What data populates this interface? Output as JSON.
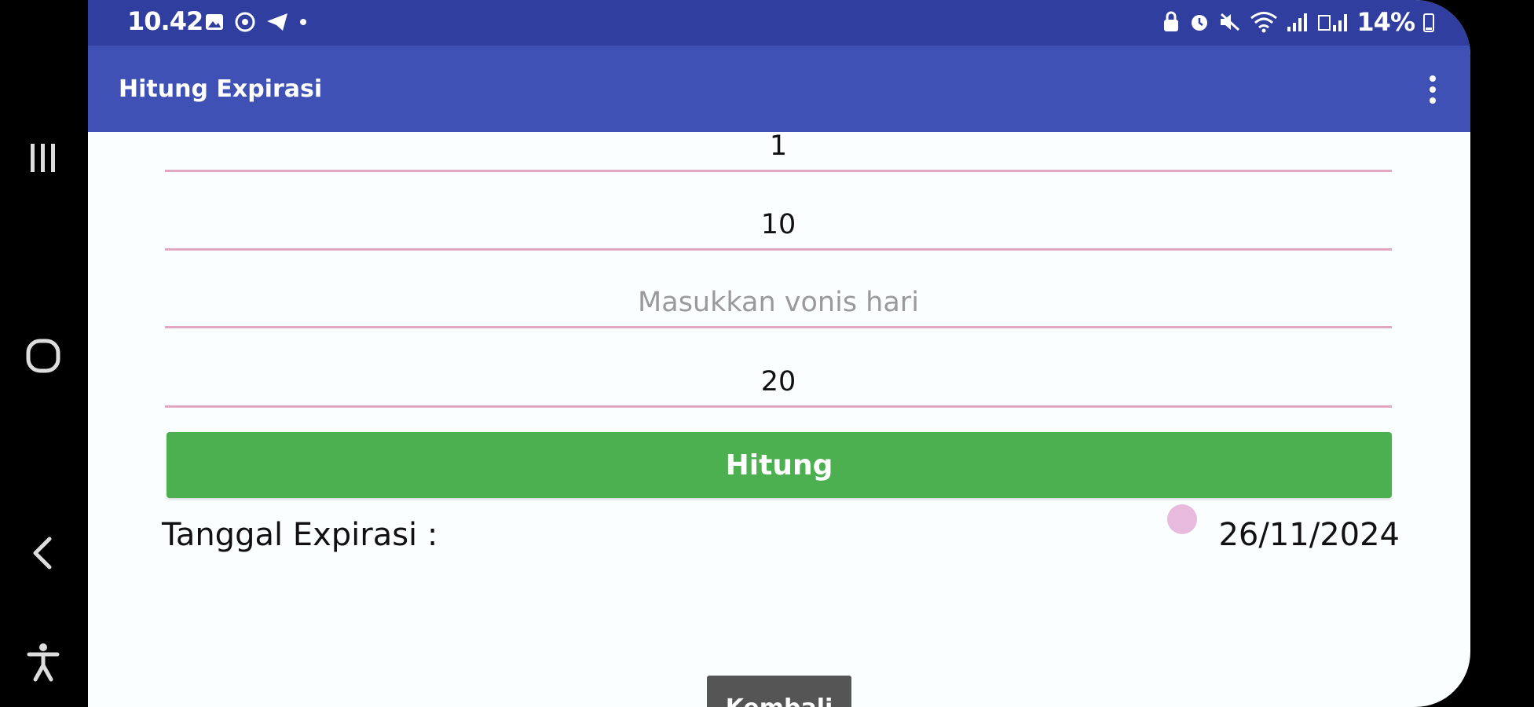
{
  "status_bar": {
    "time": "10.42",
    "battery": "14%",
    "left_icons": [
      "image-icon",
      "whatsapp-icon",
      "telegram-icon",
      "dot-icon"
    ],
    "right_icons": [
      "lock-icon",
      "alarm-icon",
      "mute-icon",
      "wifi-icon",
      "signal-icon",
      "volte-signal-icon"
    ]
  },
  "app_bar": {
    "title": "Hitung Expirasi",
    "menu_icon": "more-vert-icon"
  },
  "form": {
    "field1_value": "1",
    "field2_value": "10",
    "field3_placeholder": "Masukkan vonis hari",
    "field4_value": "20",
    "calculate_label": "Hitung"
  },
  "result": {
    "label": "Tanggal Expirasi :",
    "value": "26/11/2024"
  },
  "back_button_label": "Kembali",
  "colors": {
    "status_bar": "#303f9f",
    "app_bar": "#3f51b5",
    "button": "#4caf50",
    "field_underline": "#e0a8c2"
  }
}
